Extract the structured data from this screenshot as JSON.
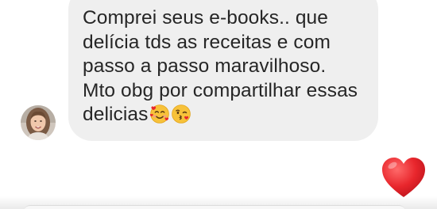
{
  "message": {
    "text": "Comprei seus e-books.. que\ndelícia tds as receitas e com\npasso a passo maravilhoso.\nMto obg por compartilhar essas\ndelicias",
    "emojis": [
      "smiling-face-with-hearts",
      "face-blowing-a-kiss"
    ]
  },
  "sender": {
    "avatar": "woman-profile-photo"
  },
  "reaction": {
    "icon": "red-heart-icon",
    "color": "#e8262c"
  },
  "colors": {
    "bubble_background": "#efefef",
    "text": "#262626"
  }
}
